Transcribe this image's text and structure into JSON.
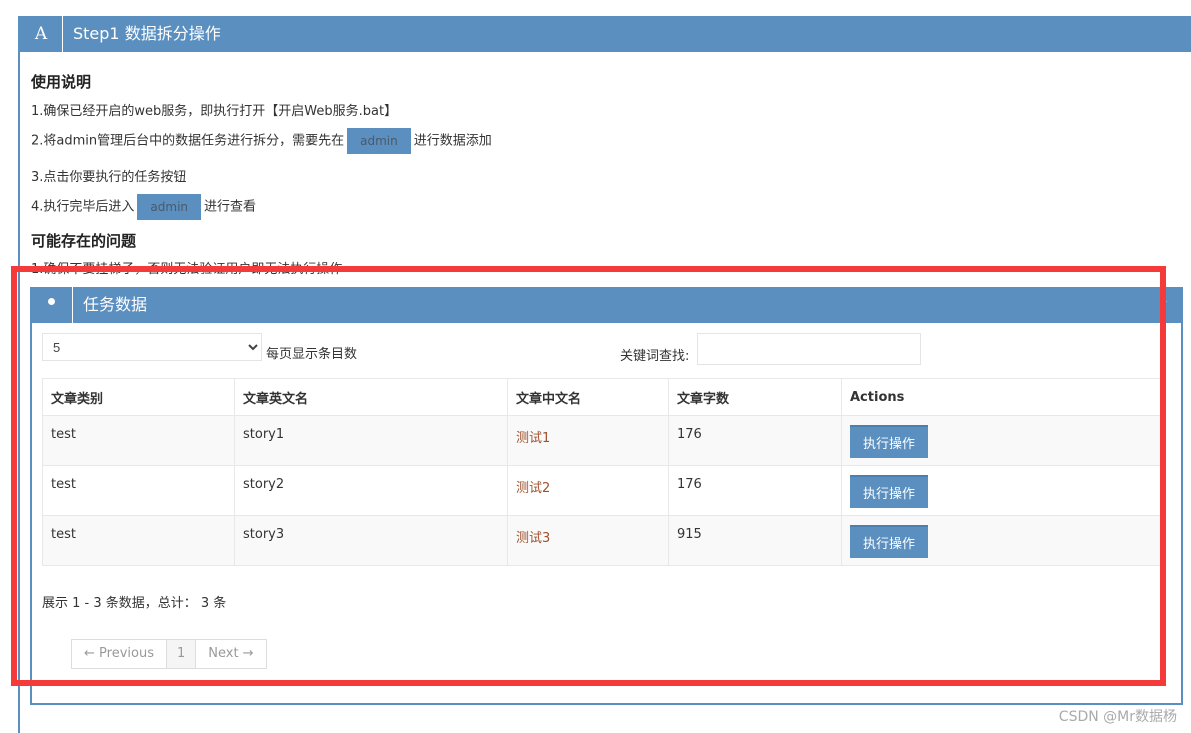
{
  "step_panel": {
    "icon_letter": "A",
    "title": "Step1 数据拆分操作"
  },
  "usage": {
    "heading": "使用说明",
    "line1": "1.确保已经开启的web服务，即执行打开【开启Web服务.bat】",
    "line2_before": "2.将admin管理后台中的数据任务进行拆分，需要先在",
    "line2_button": "admin",
    "line2_after": "进行数据添加",
    "line3": "3.点击你要执行的任务按钮",
    "line4_before": "4.执行完毕后进入",
    "line4_button": "admin",
    "line4_after": "进行查看"
  },
  "issues": {
    "heading": "可能存在的问题",
    "line1": "1.确保不要挂梯子，否则无法验证用户即无法执行操作"
  },
  "task_panel": {
    "icon": "user-icon",
    "title": "任务数据",
    "collapse_icon": "chevron-up-icon",
    "page_size": "5",
    "page_size_label": "每页显示条目数",
    "search_label": "关键词查找:",
    "search_value": "",
    "columns": [
      "文章类别",
      "文章英文名",
      "文章中文名",
      "文章字数",
      "Actions"
    ],
    "rows": [
      {
        "category": "test",
        "en": "story1",
        "cn": "测试1",
        "words": "176",
        "action": "执行操作"
      },
      {
        "category": "test",
        "en": "story2",
        "cn": "测试2",
        "words": "176",
        "action": "执行操作"
      },
      {
        "category": "test",
        "en": "story3",
        "cn": "测试3",
        "words": "915",
        "action": "执行操作"
      }
    ],
    "info": "展示 1 - 3 条数据，总计： 3 条",
    "pager": {
      "prev": "← Previous",
      "current": "1",
      "next": "Next →"
    }
  },
  "colors": {
    "primary": "#5a8fc0",
    "highlight": "#f53a3a"
  },
  "watermark": "CSDN @Mr数据杨"
}
